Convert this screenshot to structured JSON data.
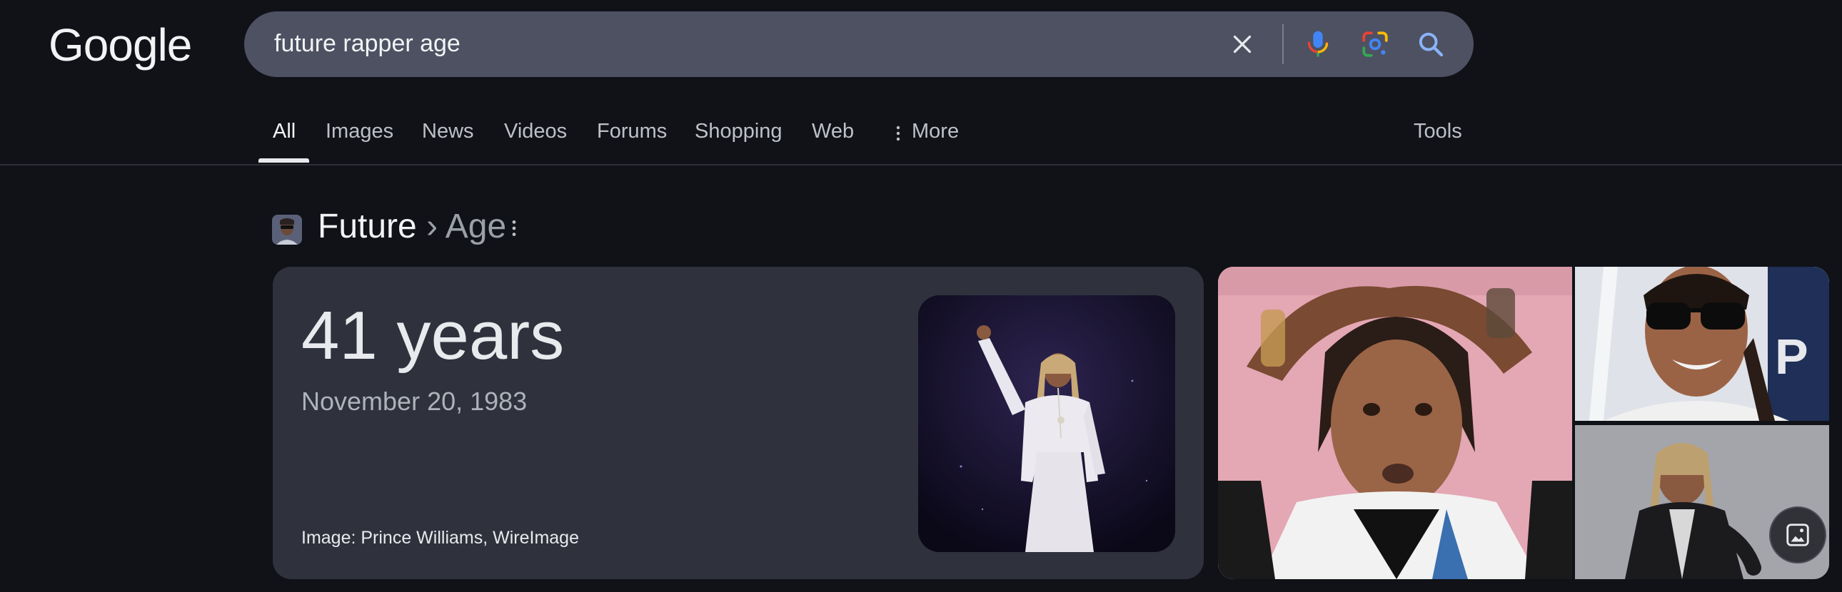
{
  "header": {
    "logo": "Google",
    "search": {
      "query": "future rapper age"
    },
    "icons": [
      "close-icon",
      "microphone-icon",
      "lens-icon",
      "search-icon"
    ]
  },
  "tabs": [
    {
      "label": "All",
      "active": true
    },
    {
      "label": "Images"
    },
    {
      "label": "News"
    },
    {
      "label": "Videos"
    },
    {
      "label": "Forums"
    },
    {
      "label": "Shopping"
    },
    {
      "label": "Web"
    },
    {
      "label": "More"
    }
  ],
  "tools_label": "Tools",
  "result": {
    "entity": "Future",
    "separator": "›",
    "attribute": "Age",
    "answer": "41 years",
    "date": "November 20, 1983",
    "image_credit": "Image: Prince Williams, WireImage"
  },
  "colors": {
    "background": "#101218",
    "search_bar": "#4d5162",
    "card": "#2f313d",
    "mic_blue": "#4285f4",
    "lens_red": "#ea4335",
    "lens_yellow": "#fbbc04",
    "lens_green": "#34a853"
  }
}
